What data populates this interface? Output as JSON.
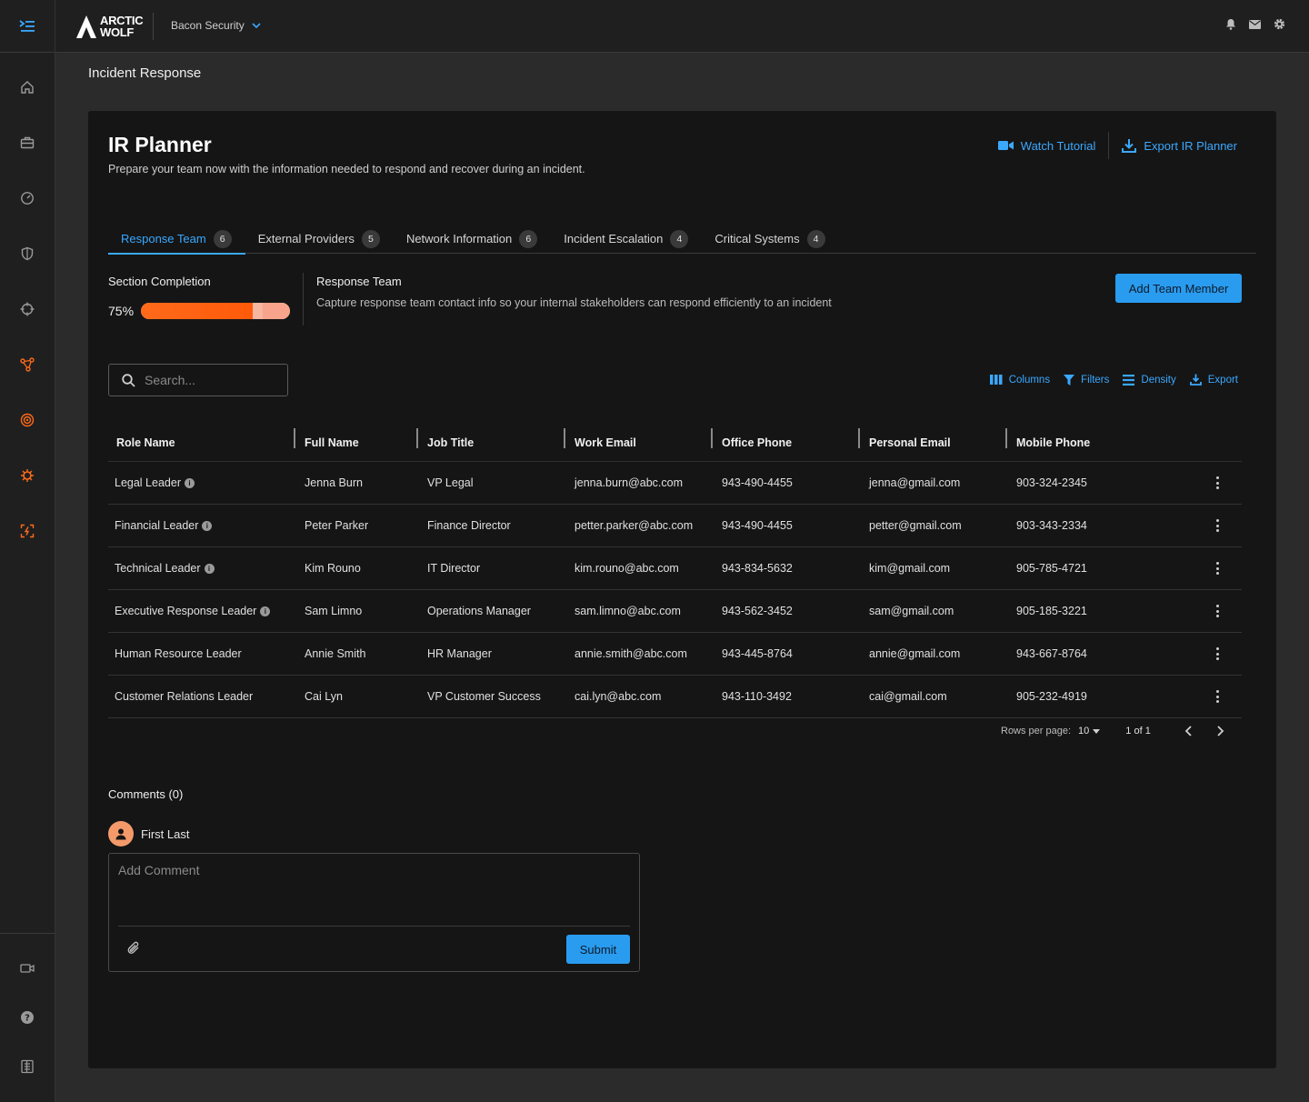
{
  "header": {
    "logo_line1": "ARCTIC",
    "logo_line2": "WOLF",
    "org_name": "Bacon Security"
  },
  "page": {
    "title": "Incident Response"
  },
  "planner": {
    "title": "IR Planner",
    "subtitle": "Prepare your team now with the information needed to respond and recover during an incident.",
    "watch_tutorial": "Watch Tutorial",
    "export_planner": "Export IR Planner"
  },
  "tabs": [
    {
      "label": "Response Team",
      "count": "6"
    },
    {
      "label": "External Providers",
      "count": "5"
    },
    {
      "label": "Network Information",
      "count": "6"
    },
    {
      "label": "Incident Escalation",
      "count": "4"
    },
    {
      "label": "Critical Systems",
      "count": "4"
    }
  ],
  "completion": {
    "label": "Section Completion",
    "percent_text": "75%",
    "percent": 0.75
  },
  "section": {
    "title": "Response Team",
    "description": "Capture response team contact info so your internal stakeholders can respond efficiently to an incident",
    "add_button": "Add Team Member"
  },
  "search": {
    "placeholder": "Search..."
  },
  "toolbar": {
    "columns": "Columns",
    "filters": "Filters",
    "density": "Density",
    "export": "Export"
  },
  "table": {
    "headers": [
      "Role Name",
      "Full Name",
      "Job Title",
      "Work Email",
      "Office Phone",
      "Personal Email",
      "Mobile Phone"
    ],
    "rows": [
      {
        "role": "Legal Leader",
        "info": true,
        "name": "Jenna Burn",
        "job": "VP Legal",
        "work_email": "jenna.burn@abc.com",
        "office_phone": "943-490-4455",
        "personal_email": "jenna@gmail.com",
        "mobile": "903-324-2345"
      },
      {
        "role": "Financial Leader",
        "info": true,
        "name": "Peter Parker",
        "job": "Finance Director",
        "work_email": "petter.parker@abc.com",
        "office_phone": "943-490-4455",
        "personal_email": "petter@gmail.com",
        "mobile": "903-343-2334"
      },
      {
        "role": "Technical Leader",
        "info": true,
        "name": "Kim Rouno",
        "job": "IT Director",
        "work_email": "kim.rouno@abc.com",
        "office_phone": "943-834-5632",
        "personal_email": "kim@gmail.com",
        "mobile": "905-785-4721"
      },
      {
        "role": "Executive Response Leader",
        "info": true,
        "name": "Sam Limno",
        "job": "Operations Manager",
        "work_email": "sam.limno@abc.com",
        "office_phone": "943-562-3452",
        "personal_email": "sam@gmail.com",
        "mobile": "905-185-3221"
      },
      {
        "role": "Human Resource Leader",
        "info": false,
        "name": "Annie Smith",
        "job": "HR Manager",
        "work_email": "annie.smith@abc.com",
        "office_phone": "943-445-8764",
        "personal_email": "annie@gmail.com",
        "mobile": "943-667-8764"
      },
      {
        "role": "Customer Relations Leader",
        "info": false,
        "name": "Cai Lyn",
        "job": "VP Customer Success",
        "work_email": "cai.lyn@abc.com",
        "office_phone": "943-110-3492",
        "personal_email": "cai@gmail.com",
        "mobile": "905-232-4919"
      }
    ]
  },
  "pagination": {
    "rows_per_page_label": "Rows per page:",
    "rows_per_page": "10",
    "page_of": "1 of 1"
  },
  "comments": {
    "title": "Comments (0)",
    "user": "First Last",
    "placeholder": "Add Comment",
    "submit": "Submit"
  },
  "colors": {
    "accent": "#3aa8ff",
    "progress": "#ff6a1a",
    "sidebar_active": "#ff6a1a"
  }
}
